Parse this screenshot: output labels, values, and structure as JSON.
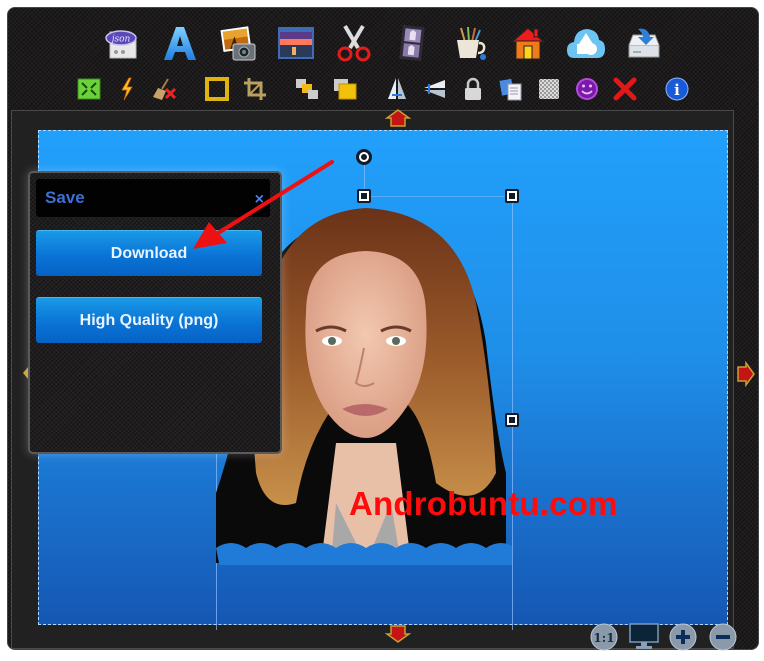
{
  "toolbar_primary": [
    {
      "name": "json-icon",
      "label": "json"
    },
    {
      "name": "text-icon",
      "label": "A"
    },
    {
      "name": "photo-camera-icon"
    },
    {
      "name": "background-image-icon"
    },
    {
      "name": "scissors-icon"
    },
    {
      "name": "filmstrip-icon"
    },
    {
      "name": "paint-brushes-icon"
    },
    {
      "name": "home-icon"
    },
    {
      "name": "cloud-shapes-icon"
    },
    {
      "name": "save-tray-icon"
    }
  ],
  "toolbar_secondary": [
    {
      "name": "fit-screen-icon"
    },
    {
      "name": "lightning-icon"
    },
    {
      "name": "clear-broom-icon"
    },
    {
      "name": "border-frame-icon"
    },
    {
      "name": "crop-icon"
    },
    {
      "name": "send-backward-icon"
    },
    {
      "name": "bring-forward-icon"
    },
    {
      "name": "flip-horizontal-icon"
    },
    {
      "name": "flip-vertical-icon"
    },
    {
      "name": "lock-icon"
    },
    {
      "name": "duplicate-icon"
    },
    {
      "name": "transparency-icon"
    },
    {
      "name": "smiley-icon"
    },
    {
      "name": "delete-icon"
    },
    {
      "name": "info-icon",
      "label": "i"
    }
  ],
  "save_panel": {
    "title": "Save",
    "close_label": "×",
    "download_label": "Download",
    "high_quality_label": "High Quality (png)"
  },
  "canvas": {
    "watermark_text": "Androbuntu.com"
  },
  "zoom_controls": {
    "actual_size_label": "1:1",
    "zoom_in_label": "+",
    "zoom_out_label": "−"
  },
  "colors": {
    "canvas_top": "#21a0fb",
    "canvas_bottom": "#1557b3",
    "button_blue": "#0a74d6",
    "watermark": "#ff0b0b",
    "annotation_arrow": "#ee1111",
    "panel_title": "#3d6fd4"
  }
}
